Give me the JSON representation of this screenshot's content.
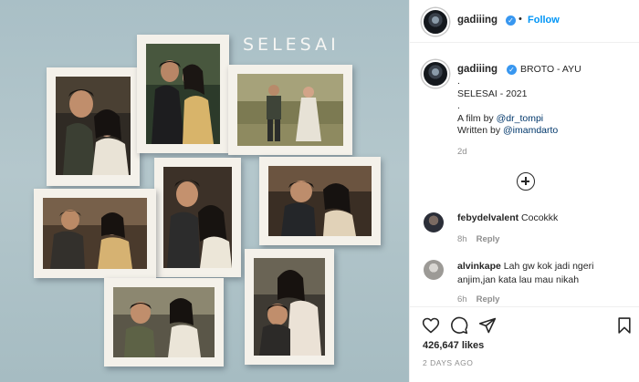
{
  "photo": {
    "overlay_title": "SELESAI",
    "frame_color": "#f4f1ea",
    "wall_color": "#afc3c8"
  },
  "header": {
    "username": "gadiiing",
    "dot": "•",
    "follow_label": "Follow"
  },
  "caption": {
    "username": "gadiiing",
    "title": "BROTO - AYU",
    "lines": [
      ".",
      "SELESAI - 2021",
      "."
    ],
    "film_prefix": "A film by ",
    "film_mention": "@dr_tompi",
    "writer_prefix": "Written by ",
    "writer_mention": "@imamdarto",
    "time": "2d"
  },
  "comments": [
    {
      "username": "febydelvalent",
      "text": "Cocokkk",
      "time": "8h",
      "reply_label": "Reply"
    },
    {
      "username": "alvinkape",
      "text_line1": "Lah gw kok jadi ngeri",
      "text_line2": "anjim,jan kata lau mau nikah",
      "time": "6h",
      "reply_label": "Reply"
    }
  ],
  "actions": {
    "likes": "426,647 likes",
    "posted": "2 DAYS AGO"
  },
  "colors": {
    "accent_blue": "#0095f6",
    "verified_blue": "#3897f0",
    "text": "#262626",
    "muted": "#8e8e8e"
  }
}
